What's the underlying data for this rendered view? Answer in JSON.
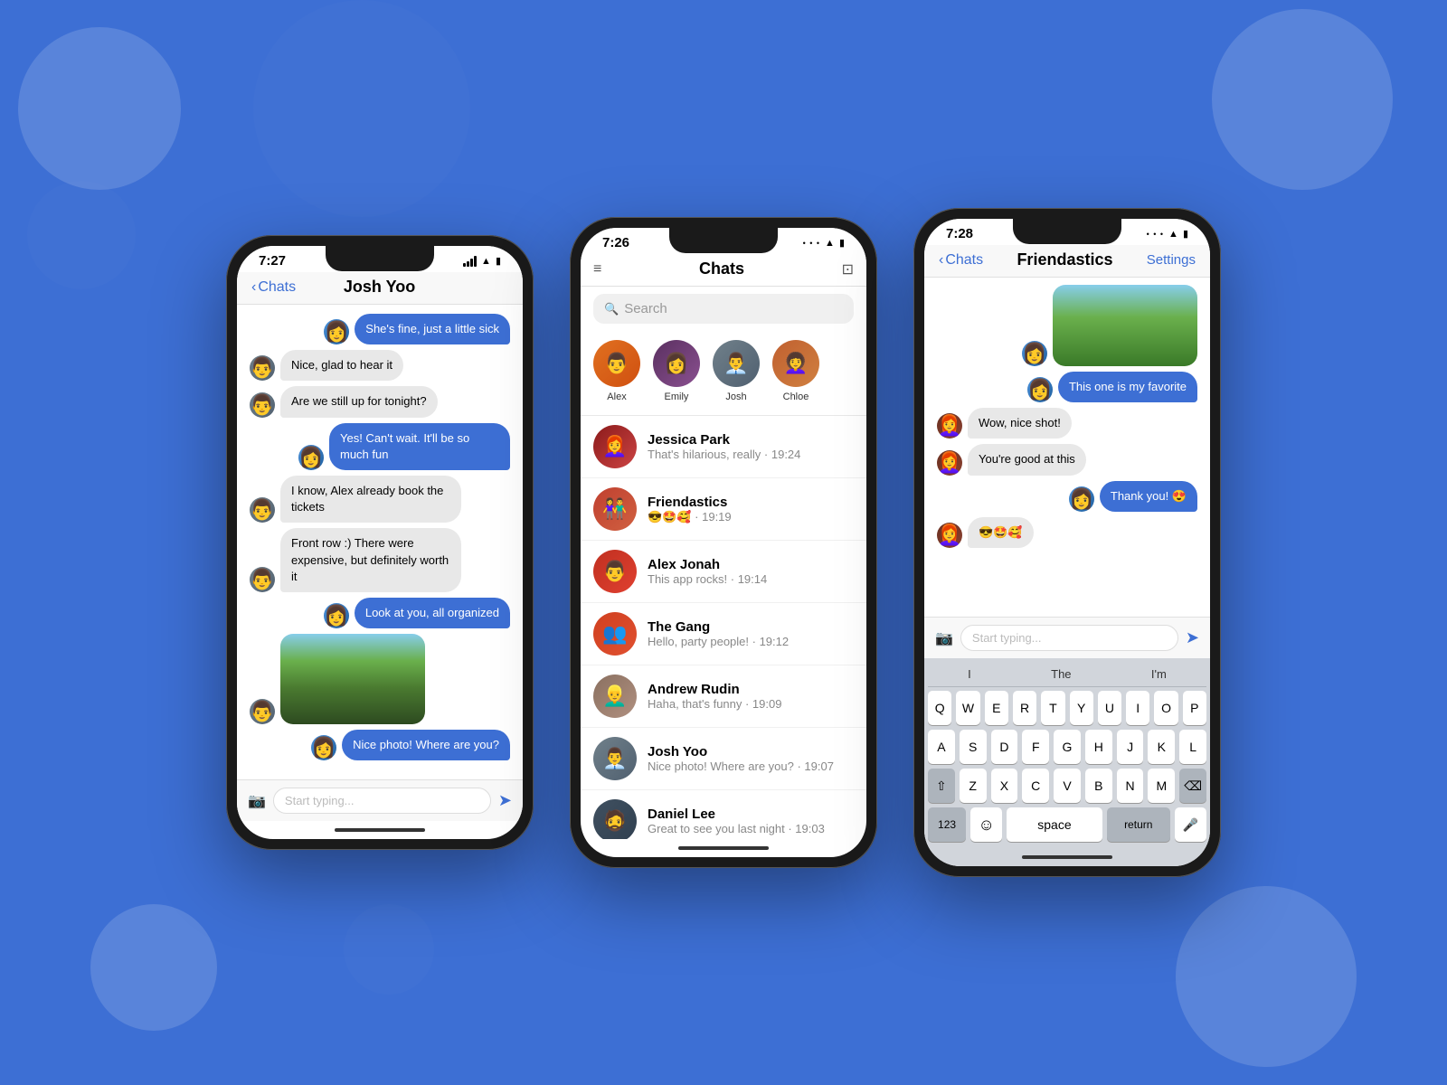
{
  "background": {
    "color": "#3d6fd4"
  },
  "phone1": {
    "time": "7:27",
    "title": "Josh Yoo",
    "back_label": "Chats",
    "messages": [
      {
        "type": "outgoing",
        "text": "She's fine, just a little sick"
      },
      {
        "type": "incoming",
        "text": "Nice, glad to hear it"
      },
      {
        "type": "incoming",
        "text": "Are we still up for tonight?"
      },
      {
        "type": "outgoing",
        "text": "Yes! Can't wait. It'll be so much fun"
      },
      {
        "type": "incoming",
        "text": "I know, Alex already book the tickets"
      },
      {
        "type": "incoming",
        "text": "Front row :) There were expensive, but definitely worth it"
      },
      {
        "type": "outgoing",
        "text": "Look at you, all organized"
      },
      {
        "type": "photo",
        "side": "incoming"
      },
      {
        "type": "outgoing",
        "text": "Nice photo! Where are you?"
      }
    ],
    "input_placeholder": "Start typing..."
  },
  "phone2": {
    "time": "7:26",
    "title": "Chats",
    "search_placeholder": "Search",
    "stories": [
      {
        "name": "Alex",
        "emoji": "👨"
      },
      {
        "name": "Emily",
        "emoji": "👩"
      },
      {
        "name": "Josh",
        "emoji": "👨‍💼"
      },
      {
        "name": "Chloe",
        "emoji": "👩‍🦱"
      }
    ],
    "chats": [
      {
        "name": "Jessica Park",
        "preview": "That's hilarious, really · 19:24"
      },
      {
        "name": "Friendastics",
        "preview": "😎🤩🥰 · 19:19"
      },
      {
        "name": "Alex Jonah",
        "preview": "This app rocks! · 19:14"
      },
      {
        "name": "The Gang",
        "preview": "Hello, party people! · 19:12"
      },
      {
        "name": "Andrew Rudin",
        "preview": "Haha, that's funny · 19:09"
      },
      {
        "name": "Josh Yoo",
        "preview": "Nice photo! Where are you? · 19:07"
      },
      {
        "name": "Daniel Lee",
        "preview": "Great to see you last night · 19:03"
      }
    ]
  },
  "phone3": {
    "time": "7:28",
    "title": "Friendastics",
    "back_label": "Chats",
    "settings_label": "Settings",
    "messages": [
      {
        "type": "photo",
        "side": "outgoing"
      },
      {
        "type": "outgoing",
        "text": "This one is my favorite"
      },
      {
        "type": "incoming",
        "text": "Wow, nice shot!"
      },
      {
        "type": "incoming",
        "text": "You're good at this"
      },
      {
        "type": "outgoing",
        "text": "Thank you! 😍"
      },
      {
        "type": "incoming",
        "text": "😎🤩🥰"
      }
    ],
    "input_placeholder": "Start typing...",
    "keyboard": {
      "suggestions": [
        "I",
        "The",
        "I'm"
      ],
      "rows": [
        [
          "Q",
          "W",
          "E",
          "R",
          "T",
          "Y",
          "U",
          "I",
          "O",
          "P"
        ],
        [
          "A",
          "S",
          "D",
          "F",
          "G",
          "H",
          "J",
          "K",
          "L"
        ],
        [
          "⇧",
          "Z",
          "X",
          "C",
          "V",
          "B",
          "N",
          "M",
          "⌫"
        ],
        [
          "123",
          "space",
          "return"
        ]
      ]
    }
  }
}
